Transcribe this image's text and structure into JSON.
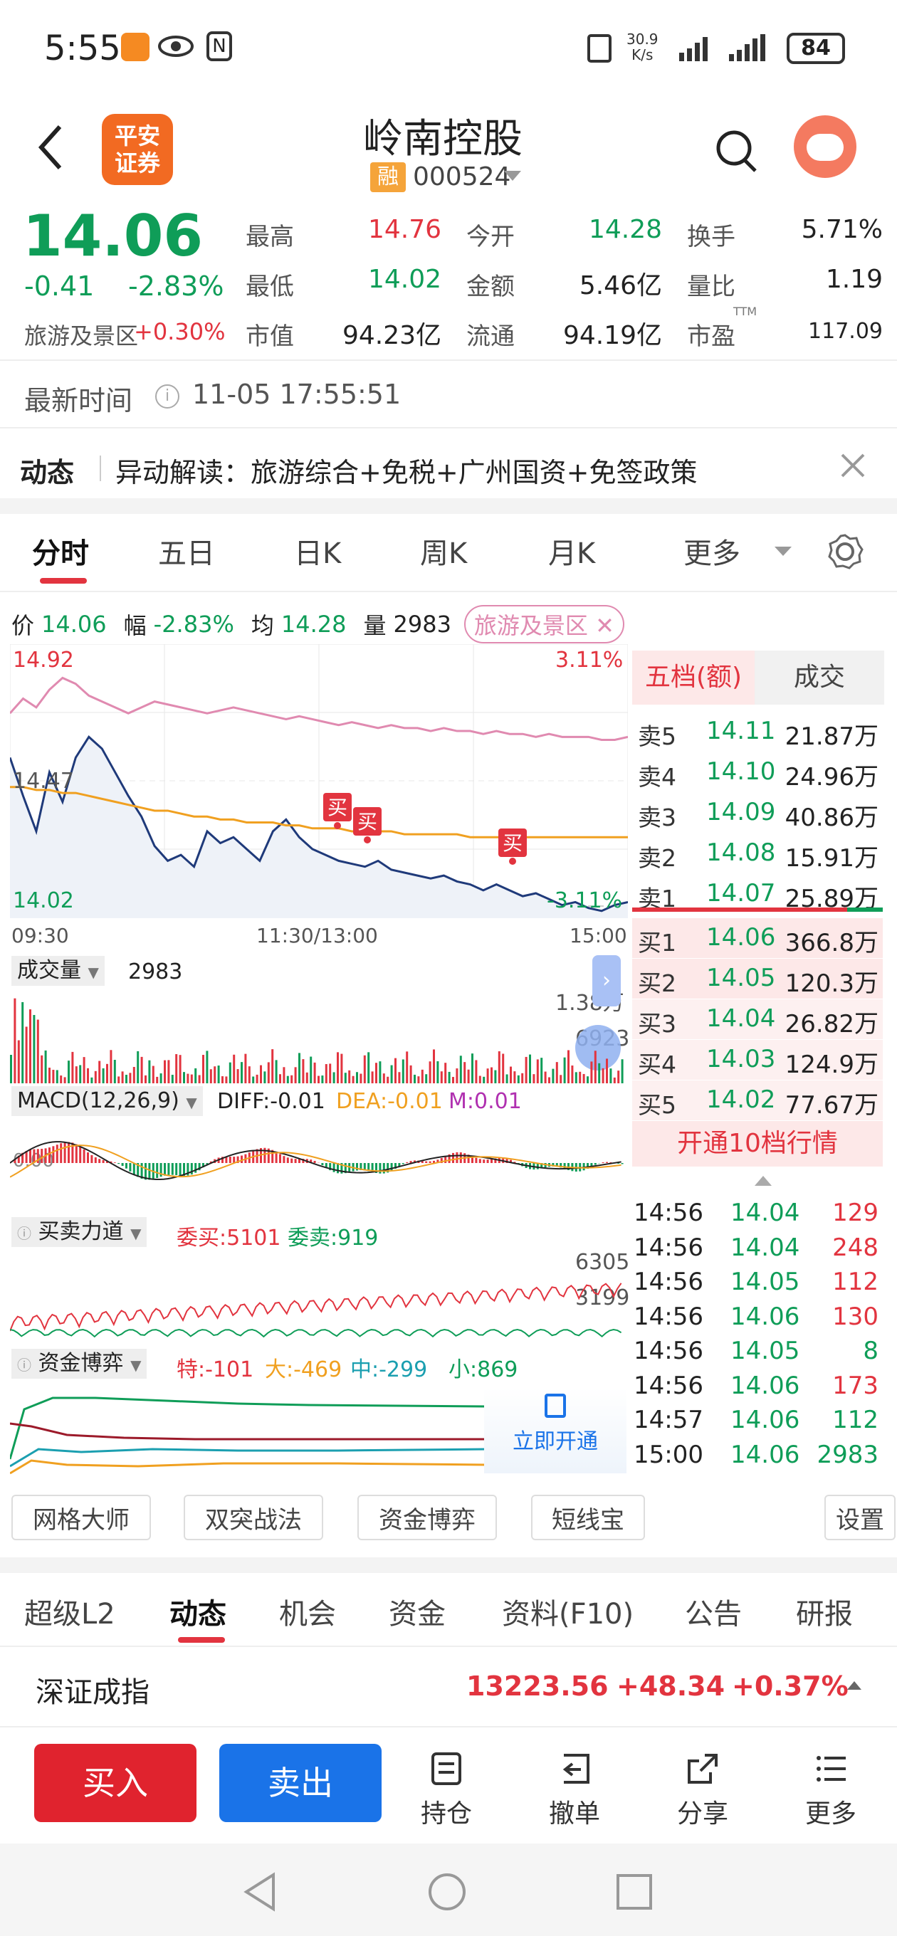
{
  "status": {
    "time": "5:55",
    "net_speed_top": "30.9",
    "net_speed_bottom": "K/s",
    "battery": "84"
  },
  "header": {
    "title": "岭南控股",
    "margin_badge": "融",
    "code": "000524",
    "broker_logo": "平安\n证券"
  },
  "quote": {
    "price": "14.06",
    "change": "-0.41",
    "change_pct": "-2.83%",
    "sector_name": "旅游及景区",
    "sector_pct": "+0.30%",
    "fields": [
      {
        "label": "最高",
        "value": "14.76",
        "color": "red"
      },
      {
        "label": "今开",
        "value": "14.28",
        "color": "green"
      },
      {
        "label": "换手",
        "value": "5.71%",
        "color": "black"
      },
      {
        "label": "最低",
        "value": "14.02",
        "color": "green"
      },
      {
        "label": "金额",
        "value": "5.46亿",
        "color": "black"
      },
      {
        "label": "量比",
        "value": "1.19",
        "color": "black"
      },
      {
        "label": "市值",
        "value": "94.23亿",
        "color": "black"
      },
      {
        "label": "流通",
        "value": "94.19亿",
        "color": "black"
      },
      {
        "label": "市盈",
        "value": "117.09",
        "color": "black"
      }
    ],
    "pe_superscript": "TTM"
  },
  "update": {
    "label": "最新时间",
    "time": "11-05 17:55:51"
  },
  "news": {
    "tag": "动态",
    "text": "异动解读：旅游综合+免税+广州国资+免签政策"
  },
  "chart_tabs": [
    "分时",
    "五日",
    "日K",
    "周K",
    "月K",
    "更多"
  ],
  "chart_summary": {
    "price_label": "价",
    "price": "14.06",
    "amp_label": "幅",
    "amp": "-2.83%",
    "avg_label": "均",
    "avg": "14.28",
    "vol_label": "量",
    "vol": "2983",
    "sector_tag": "旅游及景区"
  },
  "chart_data": {
    "type": "line",
    "y_max_label": "14.92",
    "y_max_pct": "3.11%",
    "y_mid_label": "14.47",
    "y_min_label": "14.02",
    "y_min_pct": "-3.11%",
    "x_labels": [
      "09:30",
      "11:30/13:00",
      "15:00"
    ],
    "ylim": [
      14.02,
      14.92
    ],
    "series": [
      {
        "name": "price",
        "values": [
          14.55,
          14.42,
          14.3,
          14.5,
          14.4,
          14.55,
          14.62,
          14.58,
          14.5,
          14.42,
          14.35,
          14.25,
          14.2,
          14.22,
          14.18,
          14.3,
          14.26,
          14.28,
          14.24,
          14.2,
          14.3,
          14.34,
          14.28,
          14.24,
          14.22,
          14.2,
          14.19,
          14.18,
          14.2,
          14.17,
          14.16,
          14.15,
          14.14,
          14.15,
          14.13,
          14.12,
          14.1,
          14.12,
          14.1,
          14.08,
          14.09,
          14.07,
          14.05,
          14.06,
          14.04,
          14.03,
          14.05,
          14.06
        ]
      },
      {
        "name": "avg",
        "values": [
          14.45,
          14.45,
          14.44,
          14.44,
          14.43,
          14.43,
          14.42,
          14.41,
          14.4,
          14.39,
          14.38,
          14.37,
          14.37,
          14.36,
          14.35,
          14.35,
          14.34,
          14.34,
          14.33,
          14.33,
          14.33,
          14.32,
          14.32,
          14.31,
          14.31,
          14.31,
          14.3,
          14.3,
          14.3,
          14.3,
          14.29,
          14.29,
          14.29,
          14.29,
          14.29,
          14.28,
          14.28,
          14.28,
          14.28,
          14.28,
          14.28,
          14.28,
          14.28,
          14.28,
          14.28,
          14.28,
          14.28,
          14.28
        ]
      },
      {
        "name": "sector",
        "values": [
          14.7,
          14.75,
          14.72,
          14.78,
          14.82,
          14.8,
          14.76,
          14.74,
          14.72,
          14.7,
          14.72,
          14.74,
          14.73,
          14.72,
          14.71,
          14.7,
          14.71,
          14.72,
          14.71,
          14.7,
          14.69,
          14.68,
          14.69,
          14.68,
          14.67,
          14.66,
          14.67,
          14.66,
          14.65,
          14.66,
          14.65,
          14.65,
          14.64,
          14.65,
          14.64,
          14.64,
          14.63,
          14.64,
          14.63,
          14.63,
          14.62,
          14.63,
          14.62,
          14.62,
          14.62,
          14.61,
          14.61,
          14.62
        ]
      }
    ],
    "markers": [
      "买",
      "买",
      "买"
    ]
  },
  "volume": {
    "label": "成交量",
    "value": "2983",
    "max": "1.38万",
    "mid": "6923"
  },
  "macd": {
    "label": "MACD(12,26,9)",
    "diff": "DIFF:-0.01",
    "dea": "DEA:-0.01",
    "m": "M:0.01",
    "zero": "0.00"
  },
  "force": {
    "label": "买卖力道",
    "bid": "委买:5101",
    "ask": "委卖:919",
    "max": "6305",
    "mid": "3199"
  },
  "capital": {
    "label": "资金博弈",
    "te": "特:-101",
    "da": "大:-469",
    "zhong": "中:-299",
    "xiao": "小:869",
    "unlock": "立即开通"
  },
  "orderbook": {
    "tab1": "五档(额)",
    "tab2": "成交",
    "asks": [
      {
        "label": "卖5",
        "price": "14.11",
        "amt": "21.87万"
      },
      {
        "label": "卖4",
        "price": "14.10",
        "amt": "24.96万"
      },
      {
        "label": "卖3",
        "price": "14.09",
        "amt": "40.86万"
      },
      {
        "label": "卖2",
        "price": "14.08",
        "amt": "15.91万"
      },
      {
        "label": "卖1",
        "price": "14.07",
        "amt": "25.89万"
      }
    ],
    "bids": [
      {
        "label": "买1",
        "price": "14.06",
        "amt": "366.8万"
      },
      {
        "label": "买2",
        "price": "14.05",
        "amt": "120.3万"
      },
      {
        "label": "买3",
        "price": "14.04",
        "amt": "26.82万"
      },
      {
        "label": "买4",
        "price": "14.03",
        "amt": "124.9万"
      },
      {
        "label": "买5",
        "price": "14.02",
        "amt": "77.67万"
      }
    ],
    "upgrade": "开通10档行情"
  },
  "trades": [
    {
      "time": "14:56",
      "price": "14.04",
      "vol": "129",
      "color": "red"
    },
    {
      "time": "14:56",
      "price": "14.04",
      "vol": "248",
      "color": "red"
    },
    {
      "time": "14:56",
      "price": "14.05",
      "vol": "112",
      "color": "red"
    },
    {
      "time": "14:56",
      "price": "14.06",
      "vol": "130",
      "color": "red"
    },
    {
      "time": "14:56",
      "price": "14.05",
      "vol": "8",
      "color": "green"
    },
    {
      "time": "14:56",
      "price": "14.06",
      "vol": "173",
      "color": "red"
    },
    {
      "time": "14:57",
      "price": "14.06",
      "vol": "112",
      "color": "green"
    },
    {
      "time": "15:00",
      "price": "14.06",
      "vol": "2983",
      "color": "green"
    }
  ],
  "tools": [
    "网格大师",
    "双突战法",
    "资金博弈",
    "短线宝",
    "设置"
  ],
  "bottom_tabs": [
    "超级L2",
    "动态",
    "机会",
    "资金",
    "资料(F10)",
    "公告",
    "研报"
  ],
  "index": {
    "name": "深证成指",
    "value": "13223.56",
    "change": "+48.34",
    "pct": "+0.37%"
  },
  "actions": {
    "buy": "买入",
    "sell": "卖出",
    "hold": "持仓",
    "cancel": "撤单",
    "share": "分享",
    "more": "更多"
  }
}
